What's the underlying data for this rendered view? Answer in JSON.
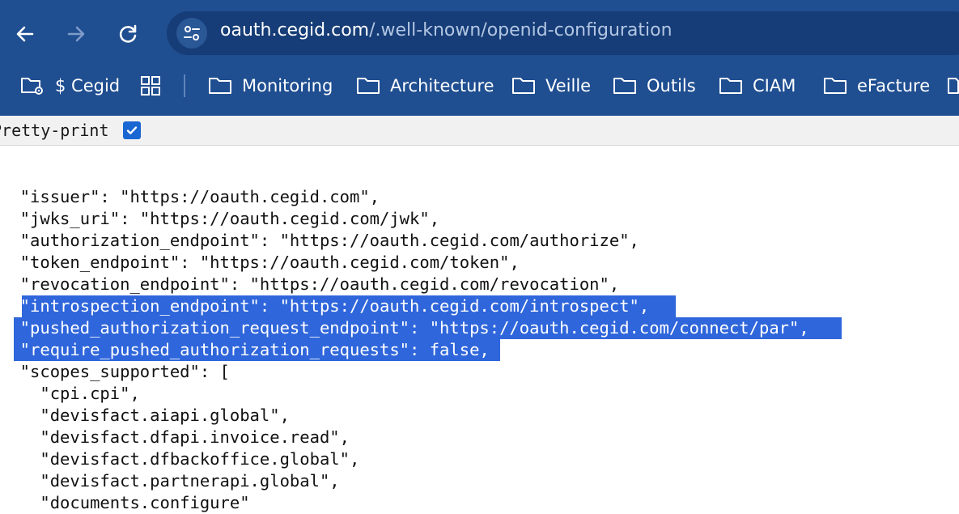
{
  "browser": {
    "url_host": "oauth.cegid.com",
    "url_path": "/.well-known/openid-configuration",
    "icons": {
      "back": "back-arrow-icon",
      "forward": "forward-arrow-icon",
      "reload": "reload-icon",
      "site_info": "tune-icon"
    }
  },
  "bookmarks": {
    "items": [
      {
        "label": "$ Cegid",
        "icon": "folder-gear-icon"
      },
      {
        "label": "",
        "icon": "apps-grid-icon"
      },
      {
        "label": "Monitoring",
        "icon": "folder-icon"
      },
      {
        "label": "Architecture",
        "icon": "folder-icon"
      },
      {
        "label": "Veille",
        "icon": "folder-icon"
      },
      {
        "label": "Outils",
        "icon": "folder-icon"
      },
      {
        "label": "CIAM",
        "icon": "folder-icon"
      },
      {
        "label": "eFacture",
        "icon": "folder-icon"
      }
    ]
  },
  "pretty_print": {
    "label": "Pretty-print",
    "checked": true
  },
  "json_view": {
    "lines": [
      "{",
      "  \"issuer\": \"https://oauth.cegid.com\",",
      "  \"jwks_uri\": \"https://oauth.cegid.com/jwk\",",
      "  \"authorization_endpoint\": \"https://oauth.cegid.com/authorize\",",
      "  \"token_endpoint\": \"https://oauth.cegid.com/token\",",
      "  \"revocation_endpoint\": \"https://oauth.cegid.com/revocation\",",
      "  \"introspection_endpoint\": \"https://oauth.cegid.com/introspect\",",
      "  \"pushed_authorization_request_endpoint\": \"https://oauth.cegid.com/connect/par\",",
      "  \"require_pushed_authorization_requests\": false,",
      "  \"scopes_supported\": [",
      "    \"cpi.cpi\",",
      "    \"devisfact.aiapi.global\",",
      "    \"devisfact.dfapi.invoice.read\",",
      "    \"devisfact.dfbackoffice.global\",",
      "    \"devisfact.partnerapi.global\",",
      "    \"documents.configure\""
    ],
    "selected_lines": [
      6,
      7,
      8
    ]
  },
  "colors": {
    "toolbar": "#1f4e91",
    "omnibox": "#163d77",
    "selection": "#2f66db",
    "checkbox": "#1a66d2"
  }
}
